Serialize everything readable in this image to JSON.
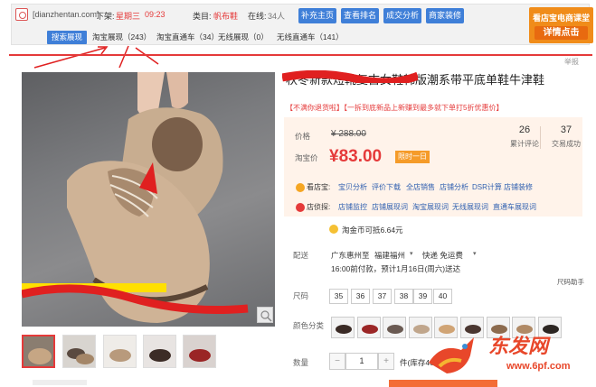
{
  "plugin": {
    "shop_url": "[dianzhentan.com]",
    "status_prefix": "下架:",
    "status_day": "星期三",
    "status_time": "09:23",
    "category_label": "类目:",
    "category_value": "帆布鞋",
    "online_label": "在线:",
    "online_value": "34人",
    "buttons": [
      "补充主页",
      "查看排名",
      "成交分析",
      "商家装修"
    ],
    "tabs": [
      "搜索展现",
      "淘宝展现（243）",
      "淘宝直通车（34）",
      "无线展现（0）",
      "无线直通车（141）"
    ],
    "promo_line1": "看店宝电商课堂",
    "promo_line2": "详情点击",
    "corner_text": "举报"
  },
  "product": {
    "title": "秋冬新款短靴复古女鞋韩版潮系带平底单鞋牛津鞋",
    "subtitle": "【不满你退货啦】【一拆到底新品上新赚到最多就下单打5折优惠价】",
    "price_label": "价格",
    "original_price": "¥ 288.00",
    "promo_label": "淘宝价",
    "promo_price": "¥83.00",
    "discount_tag": "限时一日",
    "reviews_count": "26",
    "reviews_label": "累计评论",
    "sales_count": "37",
    "sales_label": "交易成功",
    "tool1_label": "看店宝:",
    "tool1_links": [
      "宝贝分析",
      "评价下载",
      "全店销售",
      "店铺分析",
      "DSR计算",
      "店铺装修"
    ],
    "tool2_label": "店侦探:",
    "tool2_links": [
      "店铺监控",
      "店铺展现词",
      "淘宝展现词",
      "无线展现词",
      "直通车展现词"
    ],
    "coins_text": "淘金币可抵6.64元",
    "shipping_label": "配送",
    "shipping_from": "广东惠州至",
    "shipping_to": "福建福州",
    "shipping_fee": "快递 免运费",
    "shipping_eta": "16:00前付款，预计1月16日(周六)送达",
    "size_guide": "尺码助手",
    "size_label": "尺码",
    "sizes": [
      "35",
      "36",
      "37",
      "38",
      "39",
      "40"
    ],
    "color_label": "颜色分类",
    "qty_label": "数量",
    "qty_minus": "−",
    "qty_value": "1",
    "qty_plus": "+",
    "stock_text": "件(库存461",
    "thumbs_count": 5,
    "colors_count": 9
  },
  "watermark": {
    "brand": "东发网",
    "url": "www.6pf.com"
  },
  "colors": {
    "accent_blue": "#3f7fd8",
    "price_red": "#e53a3a",
    "panel_bg": "#fff3ea",
    "promo_orange": "#f08c1a"
  }
}
